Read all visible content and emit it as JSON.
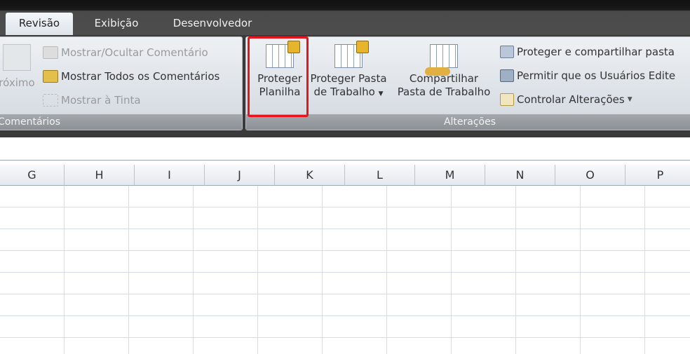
{
  "tabs": [
    {
      "label": "Revisão",
      "active": true
    },
    {
      "label": "Exibição"
    },
    {
      "label": "Desenvolvedor"
    }
  ],
  "comentarios": {
    "proximo": "róximo",
    "mostrar_ocultar": "Mostrar/Ocultar Comentário",
    "mostrar_todos": "Mostrar Todos os Comentários",
    "mostrar_tinta": "Mostrar à Tinta",
    "group_label": "Comentários"
  },
  "alteracoes": {
    "proteger_planilha": [
      "Proteger",
      "Planilha"
    ],
    "proteger_pasta": [
      "Proteger Pasta",
      "de Trabalho"
    ],
    "compartilhar": [
      "Compartilhar",
      "Pasta de Trabalho"
    ],
    "proteger_compartilhar": "Proteger e compartilhar pasta",
    "permitir": "Permitir que os Usuários Edite",
    "controlar": "Controlar Alterações",
    "group_label": "Alterações"
  },
  "columns": [
    "G",
    "H",
    "I",
    "J",
    "K",
    "L",
    "M",
    "N",
    "O",
    "P"
  ],
  "highlight_color": "#e8141b"
}
